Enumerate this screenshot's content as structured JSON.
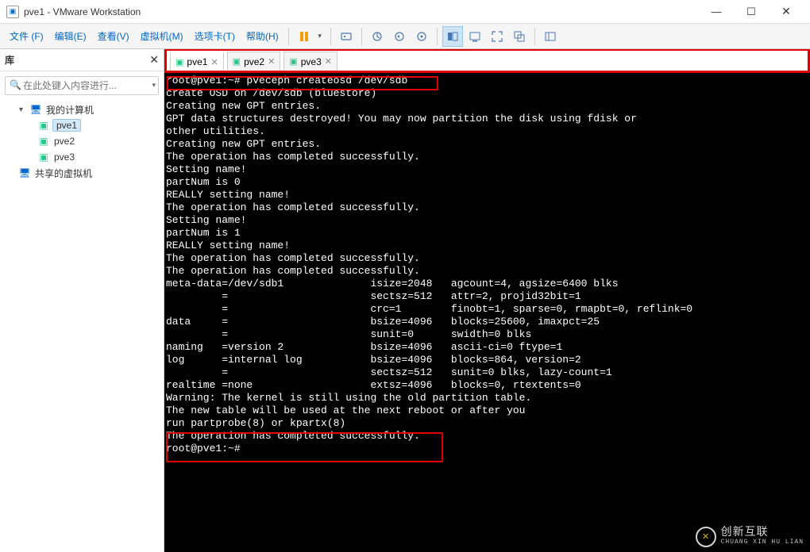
{
  "titlebar": {
    "title": "pve1 - VMware Workstation"
  },
  "menus": {
    "file": "文件 (F)",
    "edit": "编辑(E)",
    "view": "查看(V)",
    "vm": "虚拟机(M)",
    "tabs": "选项卡(T)",
    "help": "帮助(H)"
  },
  "sidebar": {
    "heading": "库",
    "search_placeholder": "在此处键入内容进行...",
    "root": "我的计算机",
    "nodes": {
      "n1": "pve1",
      "n2": "pve2",
      "n3": "pve3"
    },
    "shared": "共享的虚拟机"
  },
  "tabs": {
    "t1": "pve1",
    "t2": "pve2",
    "t3": "pve3"
  },
  "term": {
    "l00": "root@pve1:~# pveceph createosd /dev/sdb",
    "l01": "create OSD on /dev/sdb (bluestore)",
    "l02": "Creating new GPT entries.",
    "l03": "GPT data structures destroyed! You may now partition the disk using fdisk or",
    "l04": "other utilities.",
    "l05": "Creating new GPT entries.",
    "l06": "The operation has completed successfully.",
    "l07": "Setting name!",
    "l08": "partNum is 0",
    "l09": "REALLY setting name!",
    "l10": "The operation has completed successfully.",
    "l11": "Setting name!",
    "l12": "partNum is 1",
    "l13": "REALLY setting name!",
    "l14": "The operation has completed successfully.",
    "l15": "The operation has completed successfully.",
    "l16": "meta-data=/dev/sdb1              isize=2048   agcount=4, agsize=6400 blks",
    "l17": "         =                       sectsz=512   attr=2, projid32bit=1",
    "l18": "         =                       crc=1        finobt=1, sparse=0, rmapbt=0, reflink=0",
    "l19": "data     =                       bsize=4096   blocks=25600, imaxpct=25",
    "l20": "         =                       sunit=0      swidth=0 blks",
    "l21": "naming   =version 2              bsize=4096   ascii-ci=0 ftype=1",
    "l22": "log      =internal log           bsize=4096   blocks=864, version=2",
    "l23": "         =                       sectsz=512   sunit=0 blks, lazy-count=1",
    "l24": "realtime =none                   extsz=4096   blocks=0, rtextents=0",
    "l25": "Warning: The kernel is still using the old partition table.",
    "l26": "The new table will be used at the next reboot or after you",
    "l27": "run partprobe(8) or kpartx(8)",
    "l28": "The operation has completed successfully.",
    "l29": "root@pve1:~# "
  },
  "watermark": {
    "cn": "创新互联",
    "py": "CHUANG XIN HU LIAN"
  }
}
